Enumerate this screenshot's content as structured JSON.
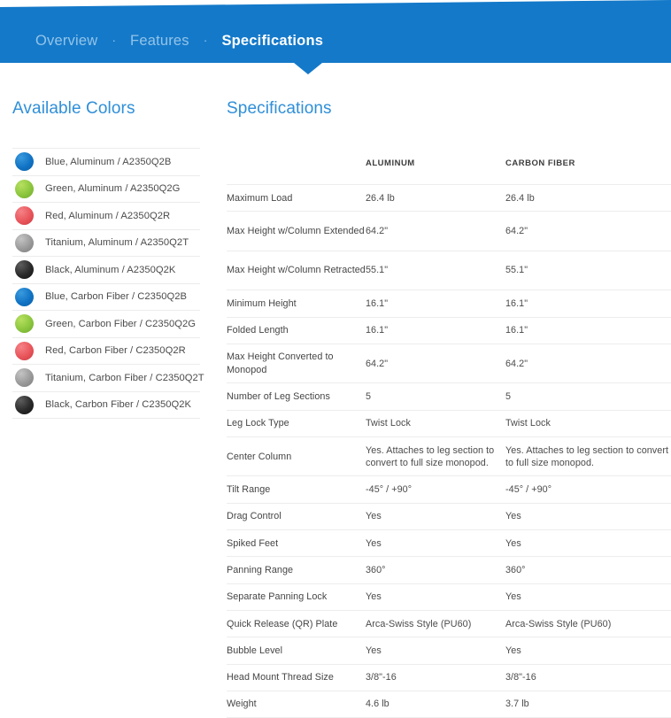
{
  "nav": {
    "separator": "·",
    "items": [
      {
        "label": "Overview",
        "active": false
      },
      {
        "label": "Features",
        "active": false
      },
      {
        "label": "Specifications",
        "active": true
      }
    ]
  },
  "colors_panel": {
    "title": "Available Colors",
    "items": [
      {
        "label": "Blue, Aluminum / A2350Q2B",
        "swatch": "blue-swatch",
        "hex": "#1173c4"
      },
      {
        "label": "Green, Aluminum / A2350Q2G",
        "swatch": "green-swatch",
        "hex": "#8cc63e"
      },
      {
        "label": "Red, Aluminum / A2350Q2R",
        "swatch": "red-swatch",
        "hex": "#e8555a"
      },
      {
        "label": "Titanium, Aluminum / A2350Q2T",
        "swatch": "titanium-swatch",
        "hex": "#9a9a9a"
      },
      {
        "label": "Black, Aluminum / A2350Q2K",
        "swatch": "black-swatch",
        "hex": "#2a2a2a"
      },
      {
        "label": "Blue, Carbon Fiber / C2350Q2B",
        "swatch": "blue-swatch",
        "hex": "#1173c4"
      },
      {
        "label": "Green, Carbon Fiber / C2350Q2G",
        "swatch": "green-swatch",
        "hex": "#8cc63e"
      },
      {
        "label": "Red, Carbon Fiber / C2350Q2R",
        "swatch": "red-swatch",
        "hex": "#e8555a"
      },
      {
        "label": "Titanium, Carbon Fiber / C2350Q2T",
        "swatch": "titanium-swatch",
        "hex": "#9a9a9a"
      },
      {
        "label": "Black, Carbon Fiber / C2350Q2K",
        "swatch": "black-swatch",
        "hex": "#2a2a2a"
      }
    ]
  },
  "specs_panel": {
    "title": "Specifications",
    "columns": [
      "",
      "ALUMINUM",
      "CARBON FIBER"
    ],
    "rows": [
      {
        "label": "Maximum Load",
        "aluminum": "26.4 lb",
        "carbon_fiber": "26.4 lb",
        "tall": false
      },
      {
        "label": "Max Height w/Column Extended",
        "aluminum": "64.2\"",
        "carbon_fiber": "64.2\"",
        "tall": true
      },
      {
        "label": "Max Height w/Column Retracted",
        "aluminum": "55.1\"",
        "carbon_fiber": "55.1\"",
        "tall": true
      },
      {
        "label": "Minimum Height",
        "aluminum": "16.1\"",
        "carbon_fiber": "16.1\"",
        "tall": false
      },
      {
        "label": "Folded Length",
        "aluminum": "16.1\"",
        "carbon_fiber": "16.1\"",
        "tall": false
      },
      {
        "label": "Max Height Converted to Monopod",
        "aluminum": "64.2\"",
        "carbon_fiber": "64.2\"",
        "tall": true
      },
      {
        "label": "Number of Leg Sections",
        "aluminum": "5",
        "carbon_fiber": "5",
        "tall": false
      },
      {
        "label": "Leg Lock Type",
        "aluminum": "Twist Lock",
        "carbon_fiber": "Twist Lock",
        "tall": false
      },
      {
        "label": "Center Column",
        "aluminum": "Yes. Attaches to leg section to convert to full size monopod.",
        "carbon_fiber": "Yes. Attaches to leg section to convert to full size monopod.",
        "tall": true
      },
      {
        "label": "Tilt Range",
        "aluminum": "-45° / +90°",
        "carbon_fiber": "-45° / +90°",
        "tall": false
      },
      {
        "label": "Drag Control",
        "aluminum": "Yes",
        "carbon_fiber": "Yes",
        "tall": false
      },
      {
        "label": "Spiked Feet",
        "aluminum": "Yes",
        "carbon_fiber": "Yes",
        "tall": false
      },
      {
        "label": "Panning Range",
        "aluminum": "360°",
        "carbon_fiber": "360°",
        "tall": false
      },
      {
        "label": "Separate Panning Lock",
        "aluminum": "Yes",
        "carbon_fiber": "Yes",
        "tall": false
      },
      {
        "label": "Quick Release (QR) Plate",
        "aluminum": "Arca-Swiss Style (PU60)",
        "carbon_fiber": "Arca-Swiss Style (PU60)",
        "tall": false
      },
      {
        "label": "Bubble Level",
        "aluminum": "Yes",
        "carbon_fiber": "Yes",
        "tall": false
      },
      {
        "label": "Head Mount Thread Size",
        "aluminum": "3/8\"-16",
        "carbon_fiber": "3/8\"-16",
        "tall": false
      },
      {
        "label": "Weight",
        "aluminum": "4.6 lb",
        "carbon_fiber": "3.7 lb",
        "tall": false
      }
    ]
  },
  "theme": {
    "brand_blue": "#1479c9",
    "heading_blue": "#2f8fd8",
    "nav_inactive": "#93c4e8",
    "nav_active": "#ffffff"
  }
}
